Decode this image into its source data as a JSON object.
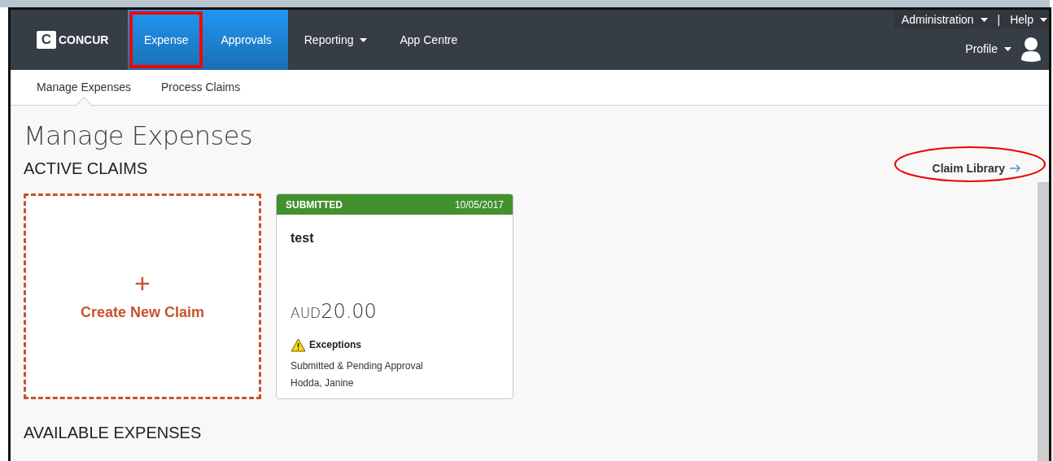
{
  "brand": {
    "name": "CONCUR",
    "mark": "C"
  },
  "nav": [
    {
      "label": "Expense",
      "selected": true,
      "highlighted": true,
      "dropdown": false
    },
    {
      "label": "Approvals",
      "selected": true,
      "highlighted": false,
      "dropdown": false
    },
    {
      "label": "Reporting",
      "selected": false,
      "highlighted": false,
      "dropdown": true
    },
    {
      "label": "App Centre",
      "selected": false,
      "highlighted": false,
      "dropdown": false
    }
  ],
  "utility_menu": [
    {
      "label": "Administration",
      "dropdown": true
    },
    {
      "label": "|",
      "dropdown": false
    },
    {
      "label": "Help",
      "dropdown": true
    }
  ],
  "profile": {
    "label": "Profile",
    "dropdown": true
  },
  "subnav": [
    {
      "label": "Manage Expenses",
      "selected": true
    },
    {
      "label": "Process Claims",
      "selected": false
    }
  ],
  "page_title": "Manage Expenses",
  "active_claims": {
    "heading": "ACTIVE CLAIMS",
    "library_link": {
      "label": "Claim Library",
      "highlighted": true
    },
    "create_tile": {
      "icon": "+",
      "label": "Create New Claim"
    },
    "claims": [
      {
        "status": "SUBMITTED",
        "color": "#43902e",
        "date": "10/05/2017",
        "name": "test",
        "currency": "AUD",
        "amount": "20.00",
        "alert": "Exceptions",
        "status_text": "Submitted & Pending Approval",
        "approver": "Hodda, Janine"
      }
    ]
  },
  "available_expenses": {
    "heading": "AVAILABLE EXPENSES"
  }
}
